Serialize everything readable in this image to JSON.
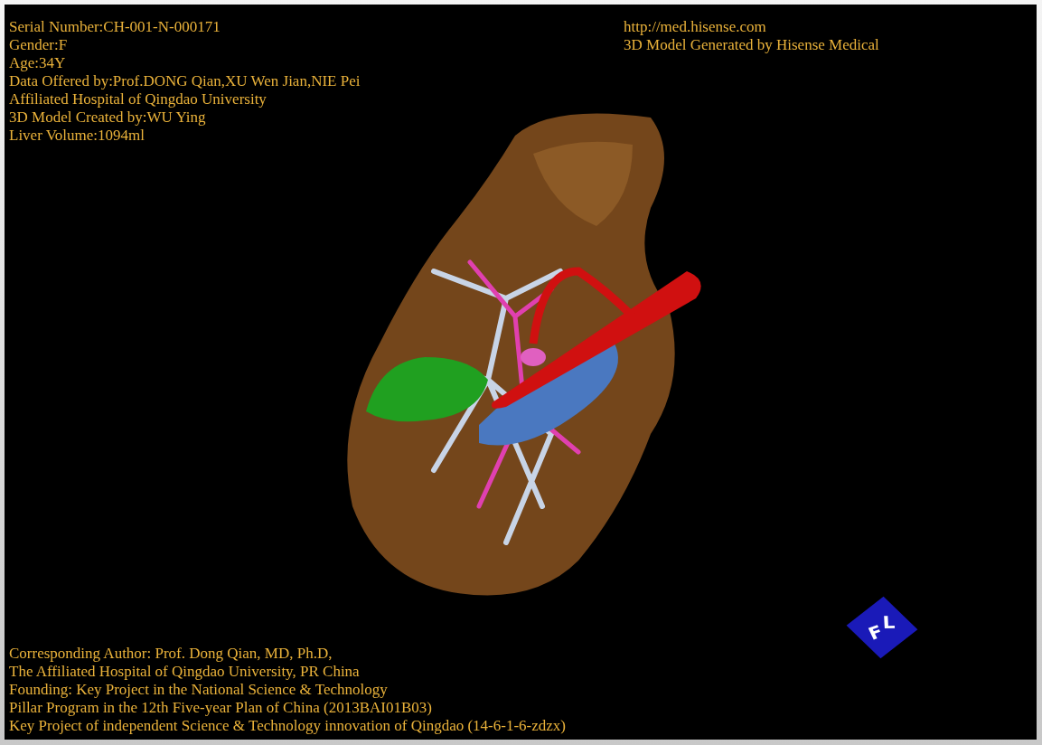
{
  "viewport": {
    "top_left": [
      "Serial Number:CH-001-N-000171",
      "Gender:F",
      "Age:34Y",
      "Data Offered by:Prof.DONG Qian,XU Wen Jian,NIE Pei",
      "Affiliated Hospital of Qingdao University",
      "3D Model Created by:WU Ying",
      "Liver Volume:1094ml"
    ],
    "top_right": [
      "http://med.hisense.com",
      "3D Model Generated by Hisense Medical"
    ],
    "bottom_left": [
      "Corresponding Author: Prof. Dong Qian, MD, Ph.D,",
      "The Affiliated Hospital of Qingdao University, PR China",
      "Founding: Key Project in the National Science & Technology",
      "Pillar Program in the 12th Five-year Plan of China (2013BAI01B03)",
      "Key Project of independent Science & Technology innovation of Qingdao (14-6-1-6-zdzx)"
    ],
    "orientation_cube": {
      "faces": [
        "F",
        "L"
      ]
    }
  }
}
